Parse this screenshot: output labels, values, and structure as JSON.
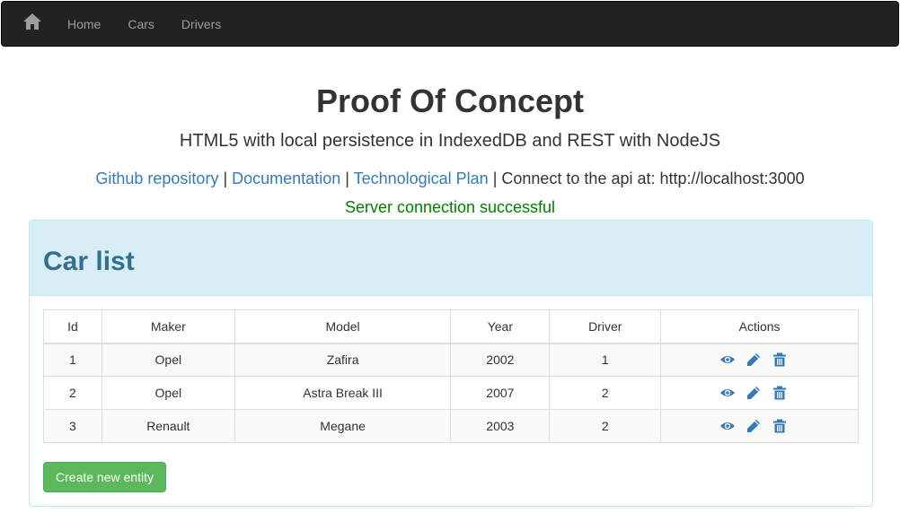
{
  "navbar": {
    "home_icon": "home-icon",
    "links": [
      "Home",
      "Cars",
      "Drivers"
    ]
  },
  "hero": {
    "title": "Proof Of Concept",
    "subtitle": "HTML5 with local persistence in IndexedDB and REST with NodeJS",
    "links": [
      "Github repository",
      "Documentation",
      "Technological Plan"
    ],
    "separator": " | ",
    "api_text": "Connect to the api at: http://localhost:3000",
    "status": "Server connection successful"
  },
  "panel": {
    "title": "Car list",
    "columns": [
      "Id",
      "Maker",
      "Model",
      "Year",
      "Driver",
      "Actions"
    ],
    "rows": [
      {
        "id": "1",
        "maker": "Opel",
        "model": "Zafira",
        "year": "2002",
        "driver": "1"
      },
      {
        "id": "2",
        "maker": "Opel",
        "model": "Astra Break III",
        "year": "2007",
        "driver": "2"
      },
      {
        "id": "3",
        "maker": "Renault",
        "model": "Megane",
        "year": "2003",
        "driver": "2"
      }
    ],
    "action_icons": [
      "eye-icon",
      "pencil-icon",
      "trash-icon"
    ],
    "create_label": "Create new entity"
  },
  "colors": {
    "navbar": "#222222",
    "link": "#337ab7",
    "success": "#008000",
    "panel_heading": "#d9edf7",
    "panel_title": "#31708f",
    "button": "#5cb85c"
  }
}
